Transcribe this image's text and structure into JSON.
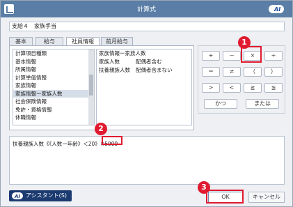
{
  "window": {
    "title": "計算式"
  },
  "logo": {
    "text": "AI"
  },
  "header": {
    "value": "支給４　家族手当"
  },
  "tabs": [
    {
      "label": "基本"
    },
    {
      "label": "給与"
    },
    {
      "label": "社員情報",
      "active": true
    },
    {
      "label": "前月給与"
    }
  ],
  "left_list": {
    "items": [
      "計算項目種類",
      "基本情報",
      "所属情報",
      "計算単価情報",
      "家族情報",
      "家族情報ー家族人数",
      "社会保険情報",
      "免許・資格情報",
      "休職情報"
    ],
    "selected_index": 5
  },
  "right_list": {
    "header": "家族情報ー家族人数",
    "rows": [
      {
        "col1": "家族人数",
        "col2": "配偶者含む"
      },
      {
        "col1": "扶養親族人数",
        "col2": "配偶者含まない"
      }
    ]
  },
  "operators": {
    "row1": [
      "+",
      "－",
      "×",
      "÷"
    ],
    "row2": [
      "＝",
      "≠",
      "（",
      "）"
    ],
    "row3": [
      ">",
      "<",
      "≧",
      "≦"
    ],
    "row4": [
      "かつ",
      "または"
    ]
  },
  "formula": {
    "text": "扶養親族人数《《人数ー年齢》＜20》×5000"
  },
  "buttons": {
    "assistant": "アシスタント(S)",
    "ok": "OK",
    "cancel": "キャンセル"
  },
  "callouts": [
    "1",
    "2",
    "3"
  ],
  "colors": {
    "titlebar": "#5a7ea6",
    "highlight": "#e01a2f",
    "assistant": "#1b3a70"
  }
}
